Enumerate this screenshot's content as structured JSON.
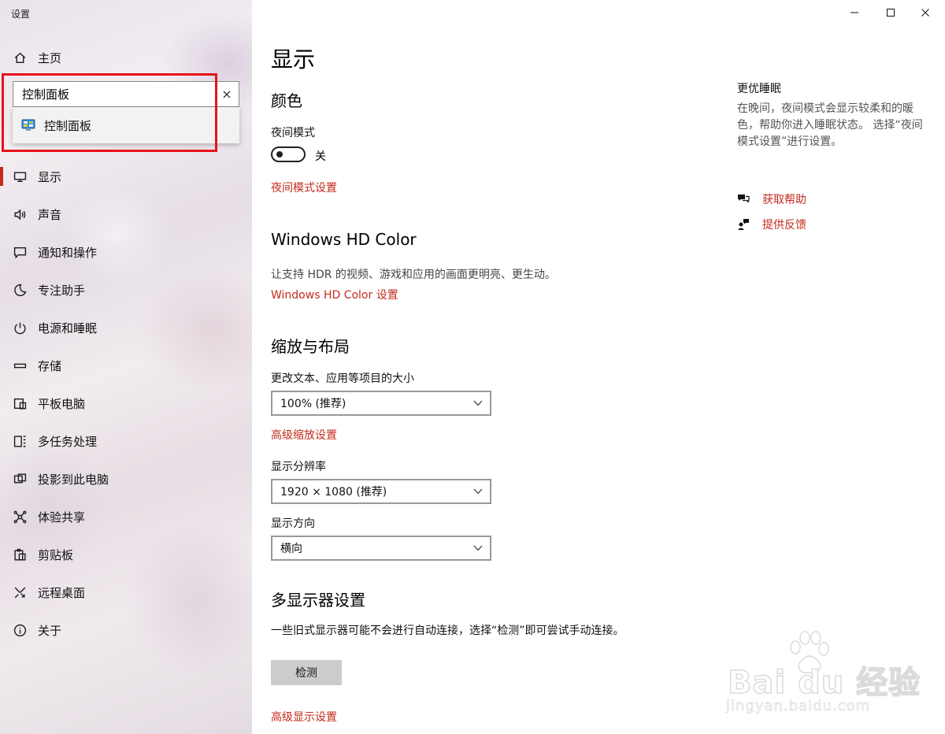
{
  "window": {
    "title": "设置"
  },
  "sidebar": {
    "home": "主页",
    "search": {
      "value": "控制面板",
      "clear": "×"
    },
    "suggestion": "控制面板",
    "items": [
      {
        "label": "显示",
        "icon": "monitor-icon"
      },
      {
        "label": "声音",
        "icon": "speaker-icon"
      },
      {
        "label": "通知和操作",
        "icon": "notification-icon"
      },
      {
        "label": "专注助手",
        "icon": "moon-icon"
      },
      {
        "label": "电源和睡眠",
        "icon": "power-icon"
      },
      {
        "label": "存储",
        "icon": "storage-icon"
      },
      {
        "label": "平板电脑",
        "icon": "tablet-icon"
      },
      {
        "label": "多任务处理",
        "icon": "multitask-icon"
      },
      {
        "label": "投影到此电脑",
        "icon": "project-icon"
      },
      {
        "label": "体验共享",
        "icon": "share-icon"
      },
      {
        "label": "剪贴板",
        "icon": "clipboard-icon"
      },
      {
        "label": "远程桌面",
        "icon": "remote-icon"
      },
      {
        "label": "关于",
        "icon": "info-icon"
      }
    ]
  },
  "main": {
    "title": "显示",
    "color": {
      "heading": "颜色",
      "night_label": "夜间模式",
      "night_state": "关",
      "night_link": "夜间模式设置"
    },
    "hdr": {
      "heading": "Windows HD Color",
      "desc": "让支持 HDR 的视频、游戏和应用的画面更明亮、更生动。",
      "link": "Windows HD Color 设置"
    },
    "scale": {
      "heading": "缩放与布局",
      "size_label": "更改文本、应用等项目的大小",
      "size_value": "100% (推荐)",
      "adv_link": "高级缩放设置",
      "res_label": "显示分辨率",
      "res_value": "1920 × 1080 (推荐)",
      "orient_label": "显示方向",
      "orient_value": "横向"
    },
    "multi": {
      "heading": "多显示器设置",
      "desc": "一些旧式显示器可能不会进行自动连接，选择“检测”即可尝试手动连接。",
      "detect": "检测",
      "adv_link": "高级显示设置"
    }
  },
  "right": {
    "title": "更优睡眠",
    "desc": "在晚间，夜间模式会显示较柔和的暖色，帮助你进入睡眠状态。 选择“夜间模式设置”进行设置。",
    "help": "获取帮助",
    "feedback": "提供反馈"
  },
  "watermark": {
    "brand": "Bai du 经验",
    "sub": "jingyan.baidu.com"
  },
  "colors": {
    "accent": "#c42b1c",
    "highlight": "#e8131a"
  }
}
